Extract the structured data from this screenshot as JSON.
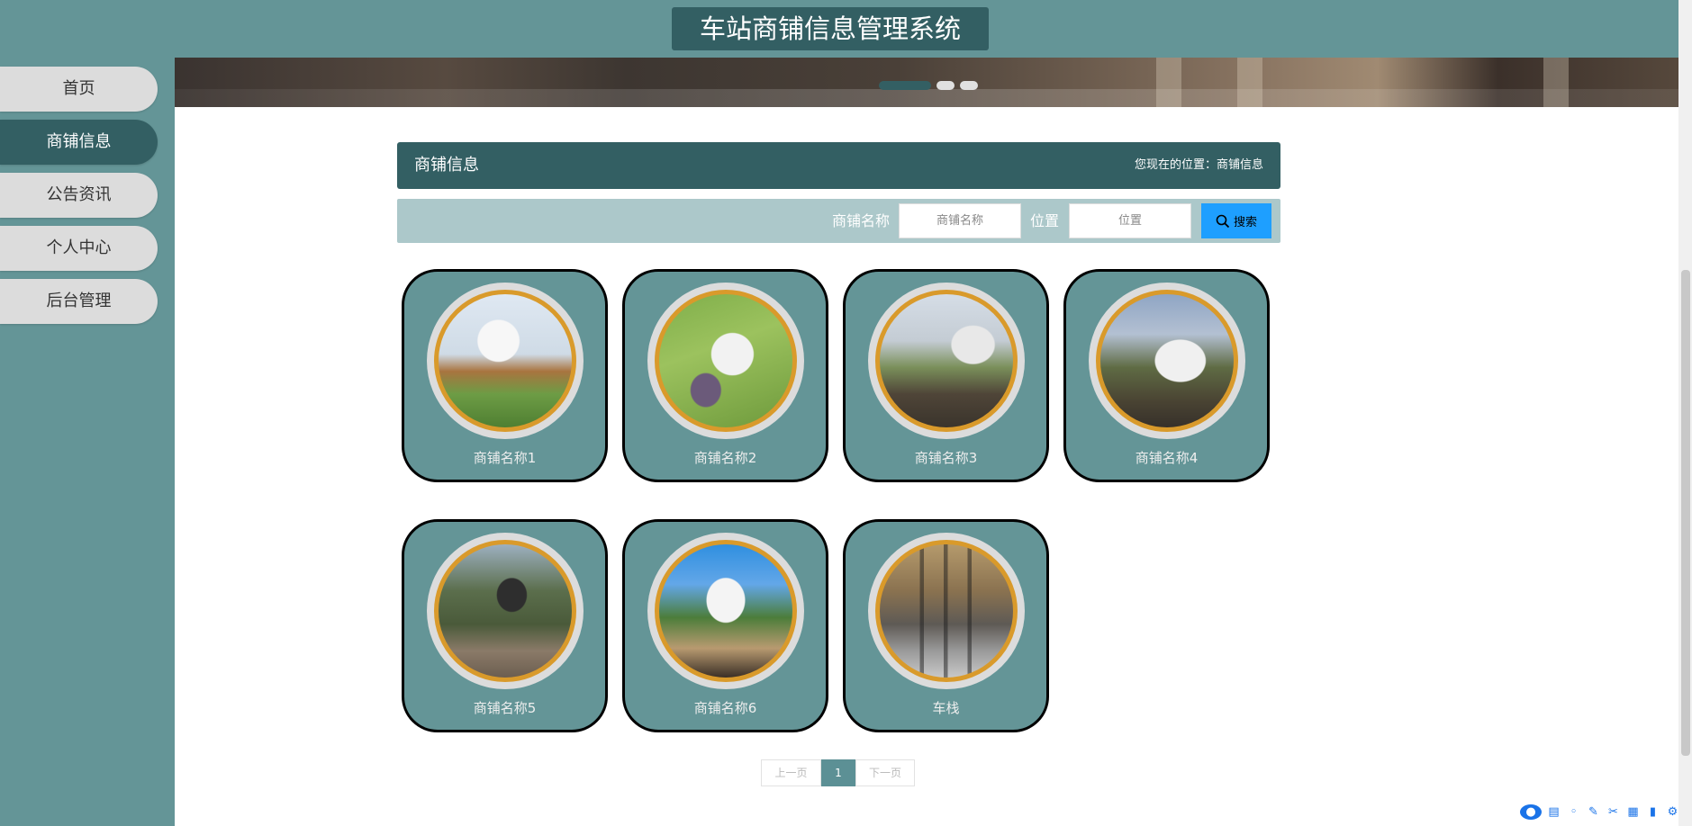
{
  "app": {
    "title": "车站商铺信息管理系统"
  },
  "sidebar": {
    "items": [
      {
        "label": "首页"
      },
      {
        "label": "商铺信息",
        "active": true
      },
      {
        "label": "公告资讯"
      },
      {
        "label": "个人中心"
      },
      {
        "label": "后台管理"
      }
    ]
  },
  "banner": {
    "dots": 3,
    "active_dot": 0
  },
  "panel": {
    "title": "商铺信息",
    "breadcrumb": "您现在的位置：商铺信息"
  },
  "search": {
    "name_label": "商铺名称",
    "name_placeholder": "商铺名称",
    "location_label": "位置",
    "location_placeholder": "位置",
    "button_label": "搜索"
  },
  "shops": [
    {
      "name": "商铺名称1",
      "image": "camper-garden-photo"
    },
    {
      "name": "商铺名称2",
      "image": "camper-lawn-photo"
    },
    {
      "name": "商铺名称3",
      "image": "campsite-house-photo"
    },
    {
      "name": "商铺名称4",
      "image": "camper-trees-photo"
    },
    {
      "name": "商铺名称5",
      "image": "garden-umbrella-photo"
    },
    {
      "name": "商铺名称6",
      "image": "campground-sign-photo"
    },
    {
      "name": "车栈",
      "image": "station-gates-photo"
    }
  ],
  "pagination": {
    "prev": "上一页",
    "current": "1",
    "next": "下一页"
  },
  "colors": {
    "teal": "#649597",
    "dark_teal": "#335f63",
    "light_teal": "#acc8ca",
    "button_blue": "#1e9fff",
    "ring_gold": "#d99a2b"
  }
}
